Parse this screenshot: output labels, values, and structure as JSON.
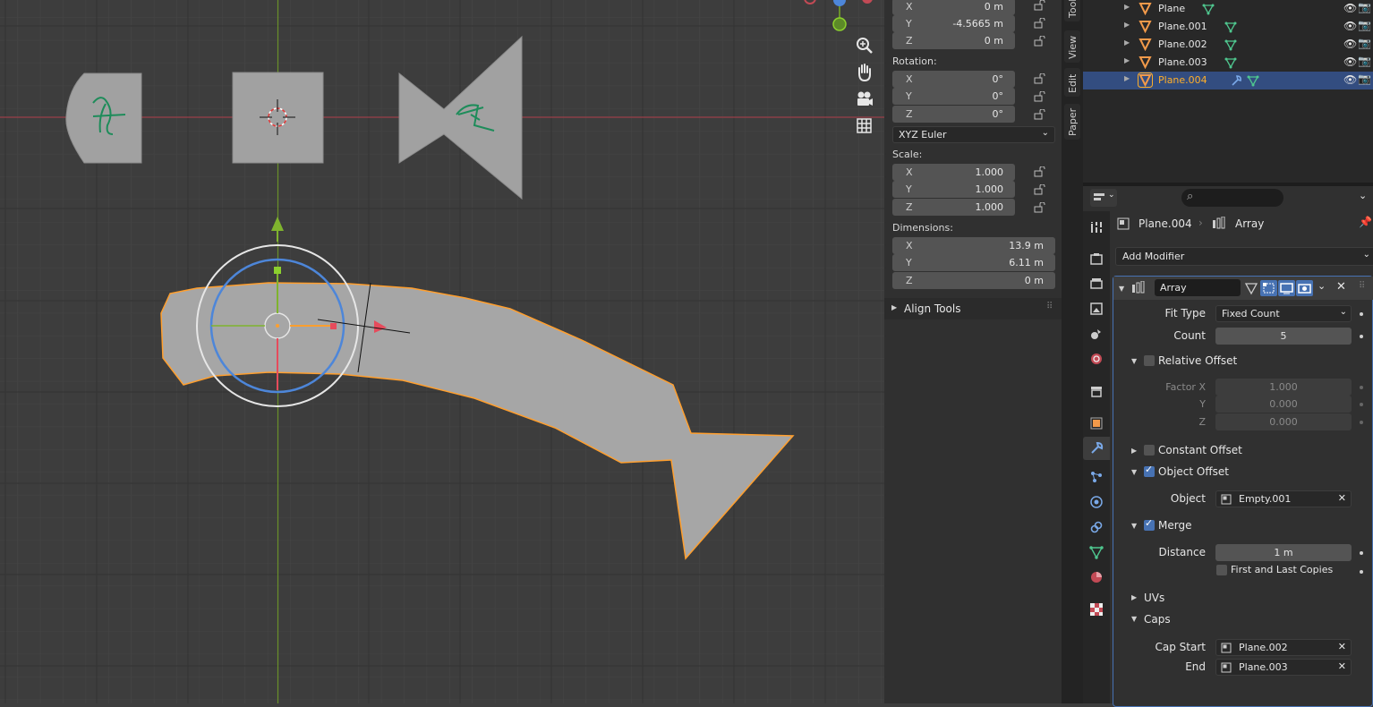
{
  "npanel": {
    "location_rows": [
      {
        "axis": "X",
        "value": "0 m"
      },
      {
        "axis": "Y",
        "value": "-4.5665 m"
      },
      {
        "axis": "Z",
        "value": "0 m"
      }
    ],
    "rotation_label": "Rotation:",
    "rotation_rows": [
      {
        "axis": "X",
        "value": "0°"
      },
      {
        "axis": "Y",
        "value": "0°"
      },
      {
        "axis": "Z",
        "value": "0°"
      }
    ],
    "rotation_mode": "XYZ Euler",
    "scale_label": "Scale:",
    "scale_rows": [
      {
        "axis": "X",
        "value": "1.000"
      },
      {
        "axis": "Y",
        "value": "1.000"
      },
      {
        "axis": "Z",
        "value": "1.000"
      }
    ],
    "dimensions_label": "Dimensions:",
    "dimension_rows": [
      {
        "axis": "X",
        "value": "13.9 m"
      },
      {
        "axis": "Y",
        "value": "6.11 m"
      },
      {
        "axis": "Z",
        "value": "0 m"
      }
    ],
    "align_tools": "Align Tools"
  },
  "side_tabs": [
    "Tool",
    "View",
    "Edit",
    "Paper"
  ],
  "outliner": {
    "items": [
      {
        "name": "Plane",
        "selected": false
      },
      {
        "name": "Plane.001",
        "selected": false
      },
      {
        "name": "Plane.002",
        "selected": false
      },
      {
        "name": "Plane.003",
        "selected": false
      },
      {
        "name": "Plane.004",
        "selected": true
      }
    ]
  },
  "properties": {
    "breadcrumb_object": "Plane.004",
    "breadcrumb_modifier": "Array",
    "add_modifier": "Add Modifier",
    "modifier_name": "Array",
    "fit_type_label": "Fit Type",
    "fit_type_value": "Fixed Count",
    "count_label": "Count",
    "count_value": "5",
    "relative_offset": "Relative Offset",
    "factor_x_label": "Factor X",
    "factor_x": "1.000",
    "factor_y_label": "Y",
    "factor_y": "0.000",
    "factor_z_label": "Z",
    "factor_z": "0.000",
    "constant_offset": "Constant Offset",
    "object_offset": "Object Offset",
    "object_label": "Object",
    "object_value": "Empty.001",
    "merge": "Merge",
    "distance_label": "Distance",
    "distance_value": "1 m",
    "first_last": "First and Last Copies",
    "uvs": "UVs",
    "caps": "Caps",
    "cap_start_label": "Cap Start",
    "cap_start_value": "Plane.002",
    "cap_end_label": "End",
    "cap_end_value": "Plane.003"
  },
  "colors": {
    "selected_outline": "#ff9f2e",
    "x_axis": "#c24a55",
    "y_axis": "#7fb32e",
    "accent": "#4772b3"
  }
}
